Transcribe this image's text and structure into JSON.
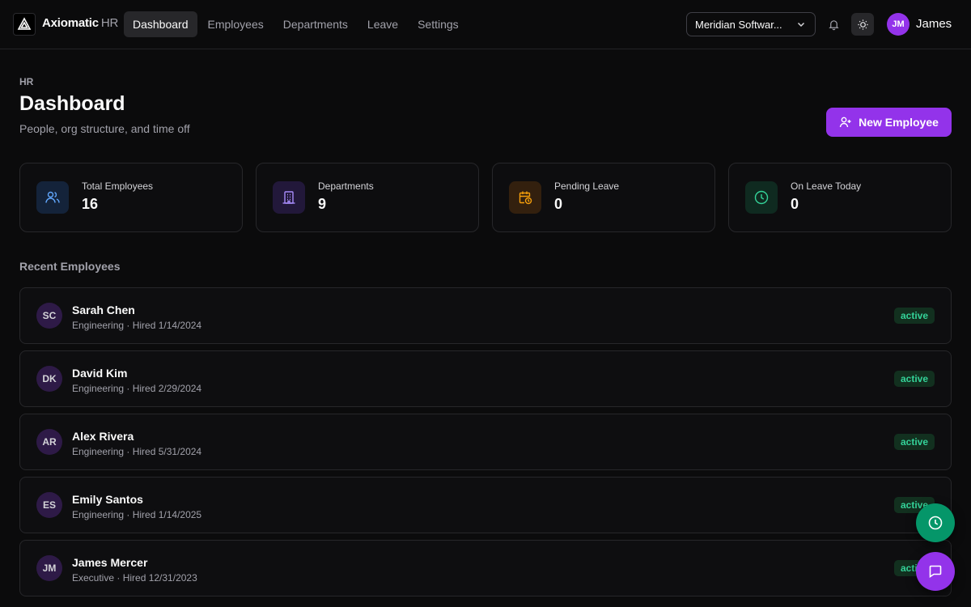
{
  "app": {
    "name": "Axiomatic",
    "suffix": "HR"
  },
  "nav": [
    {
      "label": "Dashboard",
      "active": true
    },
    {
      "label": "Employees",
      "active": false
    },
    {
      "label": "Departments",
      "active": false
    },
    {
      "label": "Leave",
      "active": false
    },
    {
      "label": "Settings",
      "active": false
    }
  ],
  "org_select": {
    "value": "Meridian Softwar..."
  },
  "user": {
    "initials": "JM",
    "name": "James"
  },
  "header": {
    "eyebrow": "HR",
    "title": "Dashboard",
    "subtitle": "People, org structure, and time off",
    "new_button": "New Employee"
  },
  "stats": [
    {
      "label": "Total Employees",
      "value": "16",
      "icon": "users-icon",
      "color": "#60a5fa"
    },
    {
      "label": "Departments",
      "value": "9",
      "icon": "building-icon",
      "color": "#a78bfa"
    },
    {
      "label": "Pending Leave",
      "value": "0",
      "icon": "calendar-clock-icon",
      "color": "#f59e0b"
    },
    {
      "label": "On Leave Today",
      "value": "0",
      "icon": "clock-icon",
      "color": "#34d399"
    }
  ],
  "recent": {
    "title": "Recent Employees",
    "employees": [
      {
        "initials": "SC",
        "name": "Sarah Chen",
        "meta": "Engineering · Hired 1/14/2024",
        "status": "active"
      },
      {
        "initials": "DK",
        "name": "David Kim",
        "meta": "Engineering · Hired 2/29/2024",
        "status": "active"
      },
      {
        "initials": "AR",
        "name": "Alex Rivera",
        "meta": "Engineering · Hired 5/31/2024",
        "status": "active"
      },
      {
        "initials": "ES",
        "name": "Emily Santos",
        "meta": "Engineering · Hired 1/14/2025",
        "status": "active"
      },
      {
        "initials": "JM",
        "name": "James Mercer",
        "meta": "Executive · Hired 12/31/2023",
        "status": "active"
      }
    ]
  },
  "colors": {
    "accent": "#9333ea",
    "success": "#059669",
    "status_active": "#34d399"
  }
}
